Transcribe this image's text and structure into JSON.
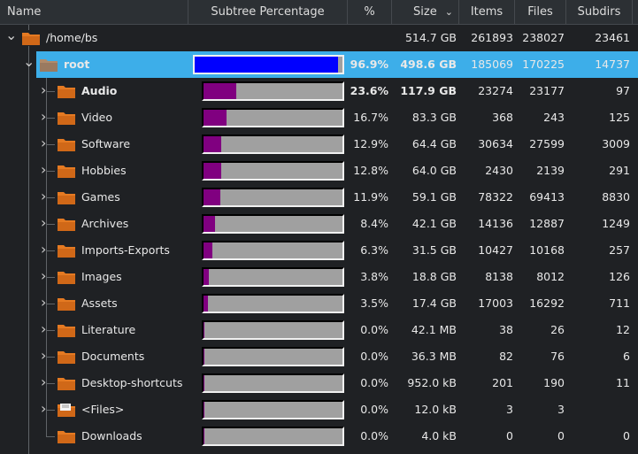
{
  "header": {
    "name": "Name",
    "subtree": "Subtree Percentage",
    "percent": "%",
    "size": "Size",
    "items": "Items",
    "files": "Files",
    "subdirs": "Subdirs"
  },
  "colors": {
    "selection": "#3daee9",
    "root_bar": "#0000ff",
    "child_bar": "#800080",
    "bar_bg": "#a0a0a0",
    "folder": "#e57a22"
  },
  "rows": [
    {
      "name": "/home/bs",
      "level": 0,
      "expanded": true,
      "percent": "",
      "fraction": null,
      "size": "514.7 GB",
      "items": "261893",
      "files": "238027",
      "subdirs": "23461",
      "icon": "folder-icon"
    },
    {
      "name": "root",
      "level": 1,
      "expanded": true,
      "selected": true,
      "bold": true,
      "percent": "96.9%",
      "fraction": 0.969,
      "size": "498.6 GB",
      "items": "185069",
      "files": "170225",
      "subdirs": "14737",
      "icon": "folder-icon"
    },
    {
      "name": "Audio",
      "level": 2,
      "bold": true,
      "percent": "23.6%",
      "fraction": 0.236,
      "size": "117.9 GB",
      "items": "23274",
      "files": "23177",
      "subdirs": "97",
      "icon": "folder-icon"
    },
    {
      "name": "Video",
      "level": 2,
      "percent": "16.7%",
      "fraction": 0.167,
      "size": "83.3 GB",
      "items": "368",
      "files": "243",
      "subdirs": "125",
      "icon": "folder-icon"
    },
    {
      "name": "Software",
      "level": 2,
      "percent": "12.9%",
      "fraction": 0.129,
      "size": "64.4 GB",
      "items": "30634",
      "files": "27599",
      "subdirs": "3009",
      "icon": "folder-icon"
    },
    {
      "name": "Hobbies",
      "level": 2,
      "percent": "12.8%",
      "fraction": 0.128,
      "size": "64.0 GB",
      "items": "2430",
      "files": "2139",
      "subdirs": "291",
      "icon": "folder-icon"
    },
    {
      "name": "Games",
      "level": 2,
      "percent": "11.9%",
      "fraction": 0.119,
      "size": "59.1 GB",
      "items": "78322",
      "files": "69413",
      "subdirs": "8830",
      "icon": "folder-icon"
    },
    {
      "name": "Archives",
      "level": 2,
      "percent": "8.4%",
      "fraction": 0.084,
      "size": "42.1 GB",
      "items": "14136",
      "files": "12887",
      "subdirs": "1249",
      "icon": "folder-icon"
    },
    {
      "name": "Imports-Exports",
      "level": 2,
      "percent": "6.3%",
      "fraction": 0.063,
      "size": "31.5 GB",
      "items": "10427",
      "files": "10168",
      "subdirs": "257",
      "icon": "folder-icon"
    },
    {
      "name": "Images",
      "level": 2,
      "percent": "3.8%",
      "fraction": 0.038,
      "size": "18.8 GB",
      "items": "8138",
      "files": "8012",
      "subdirs": "126",
      "icon": "folder-icon"
    },
    {
      "name": "Assets",
      "level": 2,
      "percent": "3.5%",
      "fraction": 0.035,
      "size": "17.4 GB",
      "items": "17003",
      "files": "16292",
      "subdirs": "711",
      "icon": "folder-icon"
    },
    {
      "name": "Literature",
      "level": 2,
      "percent": "0.0%",
      "fraction": 0.0,
      "size": "42.1 MB",
      "items": "38",
      "files": "26",
      "subdirs": "12",
      "icon": "folder-icon"
    },
    {
      "name": "Documents",
      "level": 2,
      "percent": "0.0%",
      "fraction": 0.0,
      "size": "36.3 MB",
      "items": "82",
      "files": "76",
      "subdirs": "6",
      "icon": "folder-icon"
    },
    {
      "name": "Desktop-shortcuts",
      "level": 2,
      "percent": "0.0%",
      "fraction": 0.0,
      "size": "952.0 kB",
      "items": "201",
      "files": "190",
      "subdirs": "11",
      "icon": "folder-icon"
    },
    {
      "name": "<Files>",
      "level": 2,
      "percent": "0.0%",
      "fraction": 0.0,
      "size": "12.0 kB",
      "items": "3",
      "files": "3",
      "subdirs": "",
      "icon": "files-folder-icon"
    },
    {
      "name": "Downloads",
      "level": 2,
      "leaf": true,
      "percent": "0.0%",
      "fraction": 0.0,
      "size": "4.0 kB",
      "items": "0",
      "files": "0",
      "subdirs": "0",
      "icon": "folder-icon"
    }
  ]
}
